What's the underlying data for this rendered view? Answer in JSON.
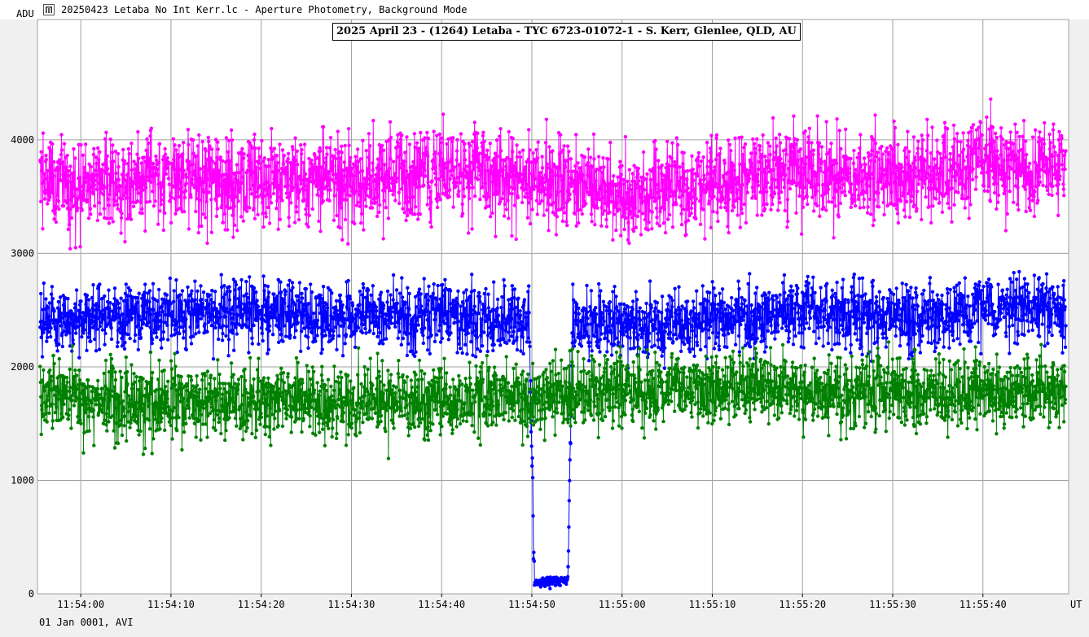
{
  "window": {
    "title": "20250423 Letaba No Int Kerr.lc - Aperture Photometry, Background Mode",
    "icon": "light-curve-app-icon"
  },
  "footer": {
    "date_text": "01 Jan 0001, AVI"
  },
  "colors": {
    "background": "#f0f0f0",
    "plot_background": "#ffffff",
    "grid": "#a0a0a0",
    "target": "#0000ff",
    "comparison_1": "#ff00ff",
    "comparison_2": "#008000"
  },
  "chart_data": {
    "type": "line",
    "title": "2025 April 23 - (1264) Letaba - TYC 6723-01072-1 - S. Kerr, Glenlee, QLD, AU",
    "xlabel": "UT",
    "ylabel": "ADU",
    "x_tick_labels": [
      "11:54:00",
      "11:54:10",
      "11:54:20",
      "11:54:30",
      "11:54:40",
      "11:54:50",
      "11:55:00",
      "11:55:10",
      "11:55:20",
      "11:55:30",
      "11:55:40"
    ],
    "x_range": [
      "11:53:55.2",
      "11:55:49.5"
    ],
    "y_ticks": [
      0,
      1000,
      2000,
      3000,
      4000
    ],
    "ylim": [
      0,
      5060
    ],
    "grid": true,
    "legend": "none",
    "series": [
      {
        "color": "#ff00ff",
        "role": "comparison_1",
        "x": [
          "11:53:55.5",
          "11:54:00.0",
          "11:54:05.0",
          "11:54:10.0",
          "11:54:15.0",
          "11:54:20.0",
          "11:54:25.0",
          "11:54:30.0",
          "11:54:35.0",
          "11:54:40.0",
          "11:54:45.0",
          "11:54:50.0",
          "11:54:55.0",
          "11:55:00.0",
          "11:55:05.0",
          "11:55:10.0",
          "11:55:15.0",
          "11:55:20.0",
          "11:55:25.0",
          "11:55:30.0",
          "11:55:35.0",
          "11:55:40.0",
          "11:55:45.0",
          "11:55:49.2"
        ],
        "values": [
          3680,
          3570,
          3630,
          3650,
          3620,
          3650,
          3640,
          3620,
          3680,
          3720,
          3720,
          3650,
          3620,
          3500,
          3560,
          3640,
          3700,
          3750,
          3660,
          3700,
          3700,
          3800,
          3760,
          3700
        ],
        "noise_amplitude": 350
      },
      {
        "color": "#0000ff",
        "role": "target",
        "x": [
          "11:53:55.5",
          "11:54:00.0",
          "11:54:05.0",
          "11:54:10.0",
          "11:54:15.0",
          "11:54:20.0",
          "11:54:25.0",
          "11:54:30.0",
          "11:54:35.0",
          "11:54:40.0",
          "11:54:45.0",
          "11:54:49.7",
          "11:54:50.3",
          "11:54:52.0",
          "11:54:54.0",
          "11:54:54.5",
          "11:54:55.0",
          "11:55:00.0",
          "11:55:05.0",
          "11:55:10.0",
          "11:55:15.0",
          "11:55:20.0",
          "11:55:25.0",
          "11:55:30.0",
          "11:55:35.0",
          "11:55:40.0",
          "11:55:45.0",
          "11:55:49.2"
        ],
        "values": [
          2430,
          2420,
          2450,
          2460,
          2470,
          2480,
          2460,
          2450,
          2460,
          2480,
          2450,
          2420,
          100,
          100,
          120,
          2400,
          2380,
          2350,
          2380,
          2400,
          2450,
          2480,
          2450,
          2420,
          2450,
          2500,
          2520,
          2500
        ],
        "noise_amplitude": 250
      },
      {
        "color": "#008000",
        "role": "comparison_2",
        "x": [
          "11:53:55.5",
          "11:54:00.0",
          "11:54:05.0",
          "11:54:10.0",
          "11:54:15.0",
          "11:54:20.0",
          "11:54:25.0",
          "11:54:30.0",
          "11:54:35.0",
          "11:54:40.0",
          "11:54:45.0",
          "11:54:50.0",
          "11:54:55.0",
          "11:55:00.0",
          "11:55:05.0",
          "11:55:10.0",
          "11:55:15.0",
          "11:55:20.0",
          "11:55:25.0",
          "11:55:30.0",
          "11:55:35.0",
          "11:55:40.0",
          "11:55:45.0",
          "11:55:49.2"
        ],
        "values": [
          1720,
          1700,
          1680,
          1700,
          1690,
          1700,
          1680,
          1690,
          1700,
          1710,
          1720,
          1740,
          1760,
          1790,
          1800,
          1810,
          1800,
          1820,
          1790,
          1800,
          1780,
          1770,
          1780,
          1780
        ],
        "noise_amplitude": 280
      }
    ]
  }
}
